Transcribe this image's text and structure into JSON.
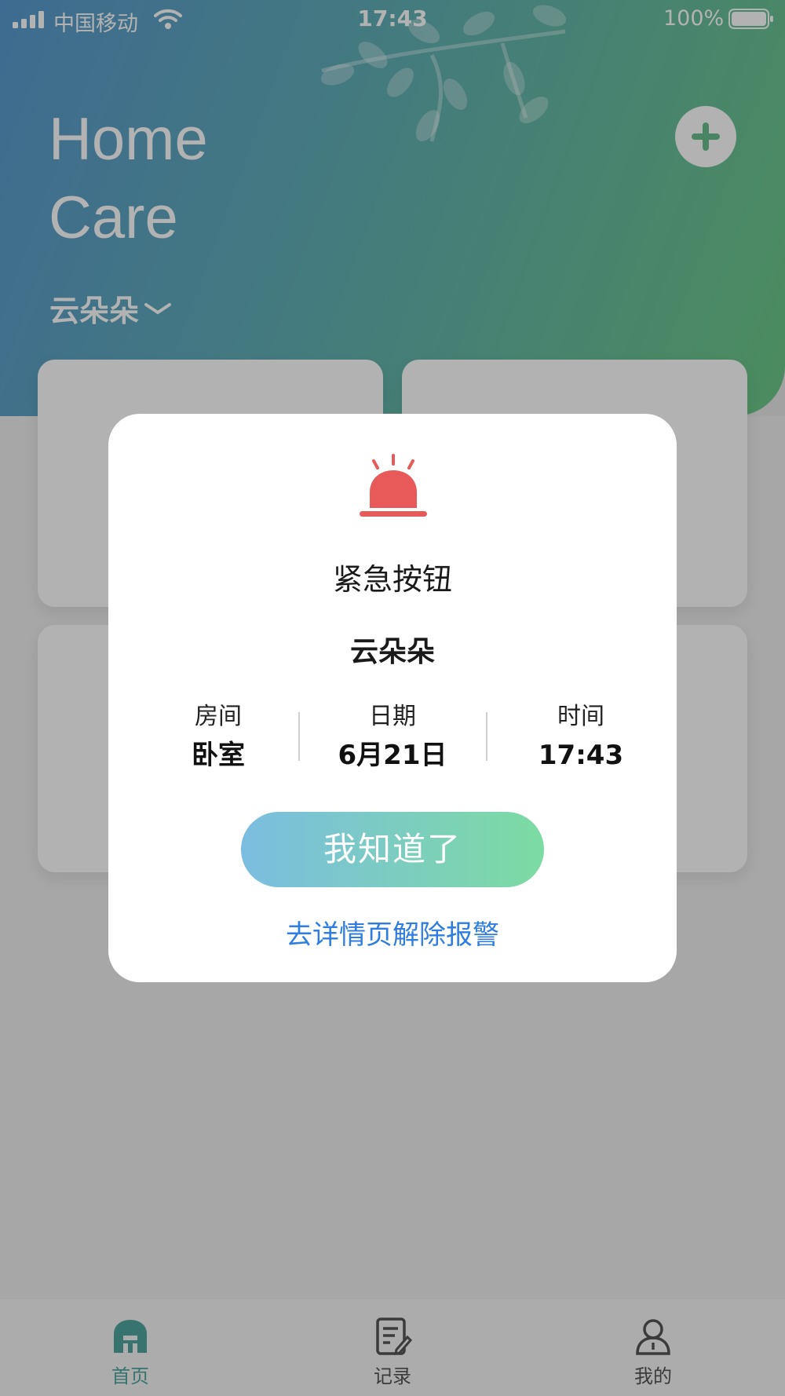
{
  "status_bar": {
    "carrier": "中国移动",
    "time": "17:43",
    "battery": "100%"
  },
  "header": {
    "title_line1": "Home",
    "title_line2": "Care",
    "user_name": "云朵朵",
    "add_icon": "plus-icon"
  },
  "tabs": [
    {
      "label": "首页",
      "icon": "home-icon",
      "active": true
    },
    {
      "label": "记录",
      "icon": "notes-icon",
      "active": false
    },
    {
      "label": "我的",
      "icon": "person-icon",
      "active": false
    }
  ],
  "alert_dialog": {
    "icon": "alarm-light-icon",
    "title": "紧急按钮",
    "user": "云朵朵",
    "room_label": "房间",
    "room_value": "卧室",
    "date_label": "日期",
    "date_value": "6月21日",
    "time_label": "时间",
    "time_value": "17:43",
    "ack_button": "我知道了",
    "detail_link": "去详情页解除报警"
  },
  "colors": {
    "alarm_red": "#e85a5a",
    "link_blue": "#2f7de0",
    "button_gradient_start": "#7bbde0",
    "button_gradient_end": "#7cdba2",
    "header_gradient_start": "#5a9ad0",
    "header_gradient_end": "#6dc987"
  }
}
